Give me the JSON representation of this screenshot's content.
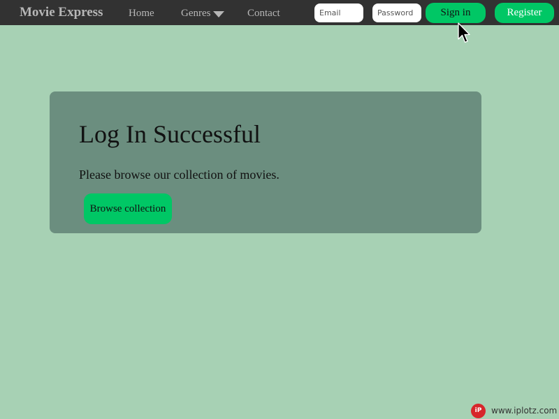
{
  "navbar": {
    "brand": "Movie Express",
    "links": {
      "home": "Home",
      "genres": "Genres",
      "contact": "Contact"
    },
    "email_placeholder": "Email",
    "password_placeholder": "Password",
    "signin_label": "Sign in",
    "register_label": "Register",
    "icons": {
      "genres_caret": "chevron-down-icon"
    },
    "colors": {
      "background": "#323232",
      "link": "#b7b7b7",
      "button": "#00c765"
    }
  },
  "main": {
    "title": "Log In Successful",
    "message": "Please browse our collection of movies.",
    "browse_label": "Browse collection",
    "colors": {
      "page_background": "#a7d1b4",
      "card_background": "#6b8e7f"
    }
  },
  "watermark": {
    "badge": "iP",
    "text": "www.iplotz.com"
  }
}
